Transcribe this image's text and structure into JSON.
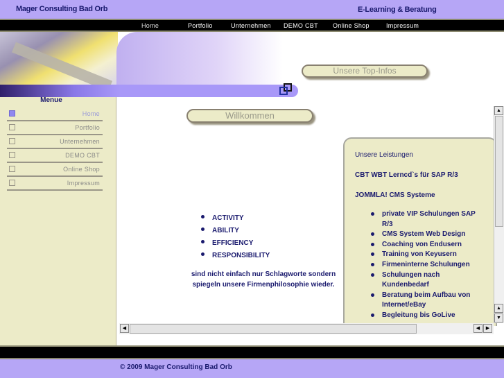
{
  "header": {
    "company": "Mager Consulting Bad Orb",
    "tagline": "E-Learning & Beratung"
  },
  "nav": [
    "Home",
    "Portfolio",
    "Unternehmen",
    "DEMO CBT",
    "Online Shop",
    "Impressum"
  ],
  "banner": {
    "top_infos": "Unsere Top-Infos"
  },
  "sidebar": {
    "title": "Menue",
    "items": [
      "Home",
      "Portfolio",
      "Unternehmen",
      "DEMO CBT",
      "Online Shop",
      "Impressum"
    ],
    "active": "Home"
  },
  "main": {
    "heading": "Willkommen",
    "values": [
      "ACTIVITY",
      "ABILITY",
      "EFFICIENCY",
      "RESPONSIBILITY"
    ],
    "text1": "sind nicht einfach nur Schlagworte sondern",
    "text2": "spiegeln unsere Firmenphilosophie wieder."
  },
  "leistungen": {
    "title": "Unsere Leistungen",
    "line1": "CBT WBT Lerncd`s für SAP R/3",
    "line2": "JOMMLA! CMS Systeme",
    "items": [
      "private VIP Schulungen SAP R/3",
      "CMS System Web Design",
      "Coaching von Endusern",
      "Training von Keyusern",
      "Firmeninterne Schulungen",
      "Schulungen nach Kundenbedarf",
      "Beratung beim Aufbau von Internet/eBay",
      "Begleitung bis GoLive"
    ]
  },
  "footer": {
    "copyright": "© 2009 Mager Consulting Bad Orb"
  },
  "colors": {
    "header": "#b6a6f6",
    "sidebar": "#ecebc8",
    "text": "#1a1a6e"
  }
}
